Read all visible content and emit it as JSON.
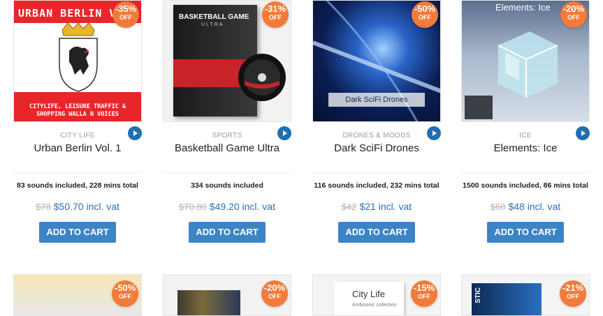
{
  "products": [
    {
      "badge_pct": "-35%",
      "badge_off": "OFF",
      "image_caption_top": "URBAN BERLIN V",
      "image_caption_bottom": "CITYLIFE, LEISURE TRAFFIC & SHOPPING WALLA N VOICES",
      "category": "CITY LIFE",
      "title": "Urban Berlin Vol. 1",
      "description": "83 sounds included, 228 mins total",
      "old_price": "$78",
      "new_price": "$50.70 incl. vat",
      "cart_label": "ADD TO CART"
    },
    {
      "badge_pct": "-31%",
      "badge_off": "OFF",
      "image_caption_top": "BASKETBALL GAME",
      "image_caption_sub": "ULTRA",
      "category": "SPORTS",
      "title": "Basketball Game Ultra",
      "description": "334 sounds included",
      "old_price": "$70.80",
      "new_price": "$49.20 incl. vat",
      "cart_label": "ADD TO CART"
    },
    {
      "badge_pct": "-50%",
      "badge_off": "OFF",
      "image_caption_bottom": "Dark SciFi Drones",
      "category": "DRONES & MOODS",
      "title": "Dark SciFi Drones",
      "description": "116 sounds included, 232 mins total",
      "old_price": "$42",
      "new_price": "$21 incl. vat",
      "cart_label": "ADD TO CART"
    },
    {
      "badge_pct": "-20%",
      "badge_off": "OFF",
      "image_caption_top": "Elements: Ice",
      "category": "ICE",
      "title": "Elements: Ice",
      "description": "1500 sounds included, 86 mins total",
      "old_price": "$60",
      "new_price": "$48 incl. vat",
      "cart_label": "ADD TO CART"
    }
  ],
  "row2": [
    {
      "badge_pct": "-50%",
      "badge_off": "OFF"
    },
    {
      "badge_pct": "-20%",
      "badge_off": "OFF"
    },
    {
      "badge_pct": "-15%",
      "badge_off": "OFF",
      "image_caption_top": "City Life",
      "image_caption_sub": "Ambisonic collection"
    },
    {
      "badge_pct": "-21%",
      "badge_off": "OFF",
      "image_caption_top": "STIC"
    }
  ],
  "colors": {
    "badge": "#f47a3a",
    "price": "#2f6fb0",
    "cart": "#3d84c6",
    "play": "#1f6fb2"
  }
}
